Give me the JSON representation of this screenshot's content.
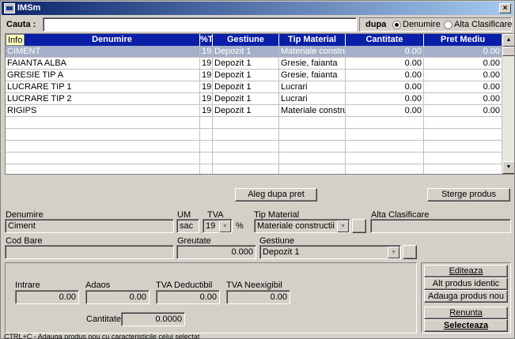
{
  "window": {
    "title": "IMSm",
    "close_glyph": "×"
  },
  "search": {
    "label": "Cauta :",
    "value": "",
    "by_label": "dupa",
    "options": [
      {
        "label": "Denumire",
        "checked": true
      },
      {
        "label": "Alta Clasificare",
        "checked": false
      }
    ]
  },
  "grid": {
    "info_label": "Info",
    "columns": [
      "Denumire",
      "%TVA",
      "Gestiune",
      "Tip Material",
      "Cantitate",
      "Pret Mediu"
    ],
    "rows": [
      {
        "denumire": "CIMENT",
        "tva": "19",
        "gestiune": "Depozit 1",
        "tip": "Materiale constructii",
        "cantitate": "0.00",
        "pret": "0.00",
        "selected": true
      },
      {
        "denumire": "FAIANTA ALBA",
        "tva": "19",
        "gestiune": "Depozit 1",
        "tip": "Gresie, faianta",
        "cantitate": "0.00",
        "pret": "0.00"
      },
      {
        "denumire": "GRESIE TIP A",
        "tva": "19",
        "gestiune": "Depozit 1",
        "tip": "Gresie, faianta",
        "cantitate": "0.00",
        "pret": "0.00"
      },
      {
        "denumire": "LUCRARE TIP 1",
        "tva": "19",
        "gestiune": "Depozit 1",
        "tip": "Lucrari",
        "cantitate": "0.00",
        "pret": "0.00"
      },
      {
        "denumire": "LUCRARE TIP 2",
        "tva": "19",
        "gestiune": "Depozit 1",
        "tip": "Lucrari",
        "cantitate": "0.00",
        "pret": "0.00"
      },
      {
        "denumire": "RIGIPS",
        "tva": "19",
        "gestiune": "Depozit 1",
        "tip": "Materiale constructii",
        "cantitate": "0.00",
        "pret": "0.00"
      }
    ],
    "empty_rows": 5
  },
  "buttons": {
    "sort_price": "Aleg dupa pret",
    "delete_product": "Sterge produs",
    "edit": "Editeaza",
    "identical": "Alt produs identic",
    "add_new": "Adauga produs nou",
    "cancel": "Renunta",
    "select": "Selecteaza"
  },
  "details": {
    "denumire_label": "Denumire",
    "denumire_value": "Ciment",
    "um_label": "UM",
    "um_value": "sac",
    "tva_label": "TVA",
    "tva_value": "19",
    "tva_unit": "%",
    "tip_label": "Tip Material",
    "tip_value": "Materiale constructii",
    "alta_label": "Alta Clasificare",
    "alta_value": "",
    "cod_label": "Cod Bare",
    "cod_value": "",
    "greutate_label": "Greutate",
    "greutate_value": "0.000",
    "gestiune_label": "Gestiune",
    "gestiune_value": "Depozit 1"
  },
  "prices": {
    "intrare_label": "Intrare",
    "intrare_value": "0.00",
    "adaos_label": "Adaos",
    "adaos_value": "0.00",
    "tva_ded_label": "TVA Deductibil",
    "tva_ded_value": "0.00",
    "tva_neex_label": "TVA Neexigibil",
    "tva_neex_value": "0.00",
    "cantitate_label": "Cantitate",
    "cantitate_value": "0.0000"
  },
  "status": "CTRL+C - Adauga produs nou cu caracteristicile celui selectat"
}
